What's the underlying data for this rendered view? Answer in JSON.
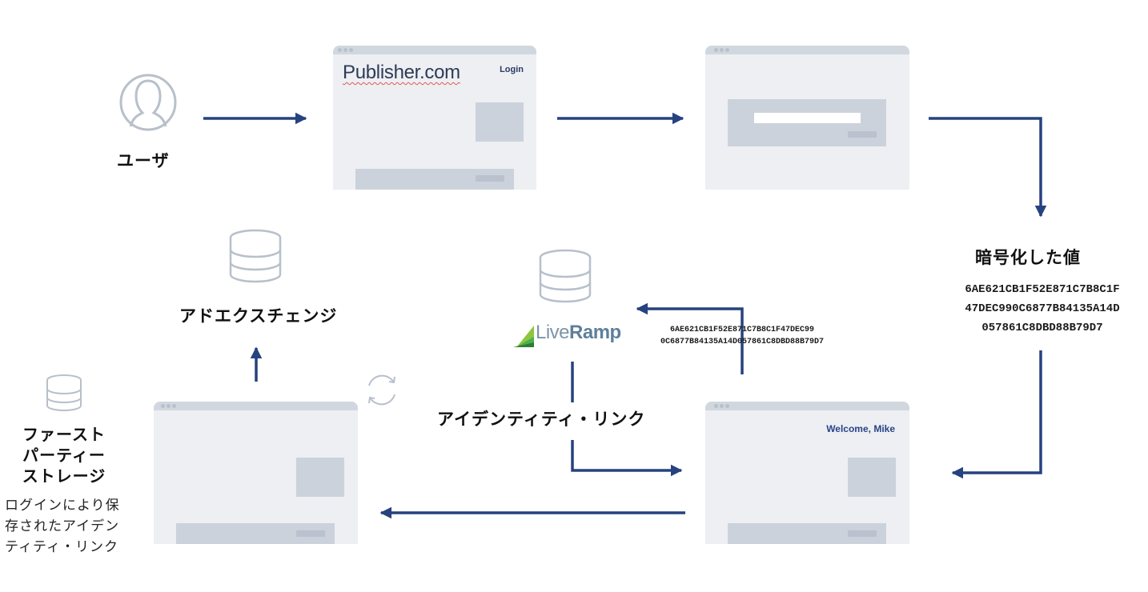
{
  "colors": {
    "arrow": "#26427f",
    "icon_stroke": "#b7c0cb",
    "browser_bg": "#edeff3",
    "browser_bar": "#d1d7df",
    "placeholder_block": "#cbd2dc",
    "welcome_text": "#2a4385",
    "liveramp_green": "#4caf50",
    "liveramp_text": "#6f8ca5"
  },
  "user": {
    "icon": "user-avatar-icon",
    "label": "ユーザ"
  },
  "publisher_page": {
    "site_title": "Publisher.com",
    "login_link": "Login"
  },
  "login_form_page": {
    "icon": "browser-window-with-form"
  },
  "encrypted_value": {
    "title": "暗号化した値",
    "lines": [
      "6AE621CB1F52E871C7B8C1F",
      "47DEC990C6877B84135A14D",
      "057861C8DBD88B79D7"
    ]
  },
  "liveramp": {
    "icon": "database-icon",
    "logo_text_light": "Live",
    "logo_text_bold": "Ramp",
    "hash_lines": [
      "6AE621CB1F52E871C7B8C1F47DEC99",
      "0C6877B84135A14D057861C8DBD88B79D7"
    ]
  },
  "identity_link": {
    "label": "アイデンティティ・リンク"
  },
  "welcome_page": {
    "greeting": "Welcome, Mike"
  },
  "ad_exchange": {
    "icon": "database-icon",
    "label": "アドエクスチェンジ"
  },
  "first_party_storage": {
    "icon": "database-icon",
    "label_lines": [
      "ファースト",
      "パーティー",
      "ストレージ"
    ],
    "description_lines": [
      "ログインにより保",
      "存されたアイデン",
      "ティティ・リンク"
    ]
  },
  "sync_icon": "refresh-sync-icon"
}
